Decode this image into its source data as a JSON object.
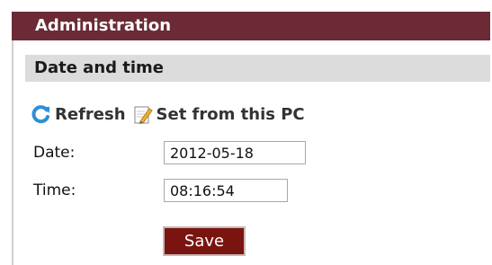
{
  "admin_header": {
    "title": "Administration"
  },
  "section": {
    "title": "Date and time"
  },
  "toolbar": {
    "refresh_label": "Refresh",
    "refresh_icon": "refresh-icon",
    "set_from_pc_label": "Set from this PC",
    "set_from_pc_icon": "edit-note-icon"
  },
  "form": {
    "date_label": "Date:",
    "date_value": "2012-05-18",
    "time_label": "Time:",
    "time_value": "08:16:54",
    "save_label": "Save"
  },
  "colors": {
    "header_bg": "#6b2a35",
    "section_bg": "#dcdcdc",
    "save_bg": "#7a1410",
    "refresh_icon": "#2f8fd6"
  }
}
